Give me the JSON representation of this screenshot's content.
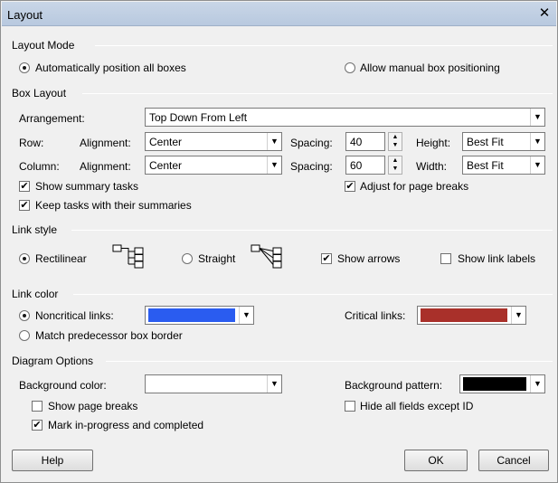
{
  "window": {
    "title": "Layout",
    "close_symbol": "✕"
  },
  "layout_mode": {
    "label": "Layout Mode",
    "auto_label": "Automatically position all boxes",
    "manual_label": "Allow manual box positioning",
    "selected": "auto"
  },
  "box_layout": {
    "label": "Box Layout",
    "arrangement_label": "Arrangement:",
    "arrangement_value": "Top Down From Left",
    "row_label": "Row:",
    "column_label": "Column:",
    "alignment_label": "Alignment:",
    "row_alignment": "Center",
    "column_alignment": "Center",
    "spacing_label": "Spacing:",
    "row_spacing": "40",
    "column_spacing": "60",
    "height_label": "Height:",
    "height_value": "Best Fit",
    "width_label": "Width:",
    "width_value": "Best Fit",
    "show_summary_label": "Show summary tasks",
    "show_summary_checked": true,
    "keep_tasks_label": "Keep tasks with their summaries",
    "keep_tasks_checked": true,
    "adjust_breaks_label": "Adjust for page breaks",
    "adjust_breaks_checked": true
  },
  "link_style": {
    "label": "Link style",
    "rectilinear_label": "Rectilinear",
    "straight_label": "Straight",
    "selected": "rectilinear",
    "show_arrows_label": "Show arrows",
    "show_arrows_checked": true,
    "show_link_labels_label": "Show link labels",
    "show_link_labels_checked": false
  },
  "link_color": {
    "label": "Link color",
    "noncritical_label": "Noncritical links:",
    "noncritical_color": "#2a5cf0",
    "critical_label": "Critical links:",
    "critical_color": "#a9302a",
    "match_label": "Match predecessor box border",
    "selected": "noncritical"
  },
  "diagram_options": {
    "label": "Diagram Options",
    "bg_color_label": "Background color:",
    "bg_color_value": "#ffffff",
    "bg_pattern_label": "Background pattern:",
    "bg_pattern_value": "#000000",
    "show_page_breaks_label": "Show page breaks",
    "show_page_breaks_checked": false,
    "hide_fields_label": "Hide all fields except ID",
    "hide_fields_checked": false,
    "mark_progress_label": "Mark in-progress and completed",
    "mark_progress_checked": true
  },
  "buttons": {
    "help": "Help",
    "ok": "OK",
    "cancel": "Cancel"
  },
  "icons": {
    "dropdown": "chevron-down-icon",
    "check": "✔"
  }
}
